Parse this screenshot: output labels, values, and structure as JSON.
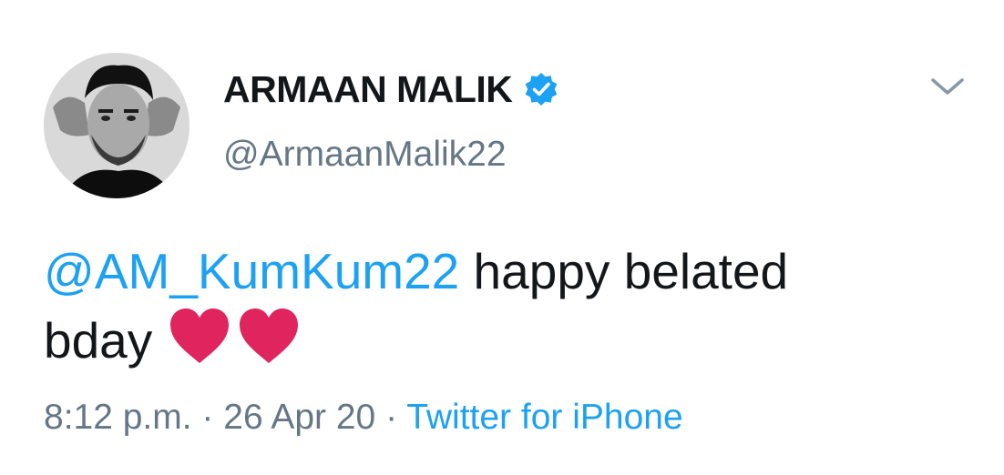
{
  "tweet": {
    "author": {
      "display_name": "ARMAAN MALIK",
      "handle": "@ArmaanMalik22",
      "verified": true
    },
    "text": {
      "mention": "@AM_KumKum22",
      "body_line1": " happy belated",
      "body_line2": "bday"
    },
    "emoji": [
      "red-heart",
      "red-heart"
    ],
    "meta": {
      "time": "8:12 p.m.",
      "sep1": " · ",
      "date": "26 Apr 20",
      "sep2": " · ",
      "source": "Twitter for iPhone"
    }
  },
  "colors": {
    "text": "#14171a",
    "secondary": "#657786",
    "link": "#1da1f2",
    "heart": "#e0245e"
  }
}
